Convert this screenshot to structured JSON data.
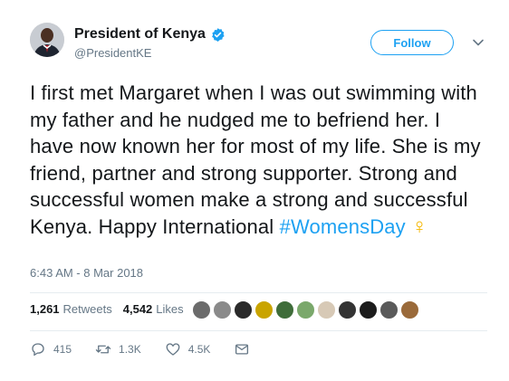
{
  "user": {
    "name": "President of Kenya",
    "handle": "@PresidentKE"
  },
  "follow_label": "Follow",
  "tweet": {
    "text_main": "I first met Margaret when I was out swimming with my father and he nudged me to befriend her. I have now known her for most of my life. She is my friend, partner and strong supporter.  Strong and successful women make a strong and successful Kenya. Happy International ",
    "hashtag": "#WomensDay",
    "emoji": "♀",
    "timestamp": "6:43 AM - 8 Mar 2018"
  },
  "stats": {
    "retweets_count": "1,261",
    "retweets_label": "Retweets",
    "likes_count": "4,542",
    "likes_label": "Likes"
  },
  "likers": [
    "#6b6b6b",
    "#8a8a8a",
    "#2a2a2a",
    "#c9a400",
    "#3f6d3a",
    "#7aa86b",
    "#d7c9b6",
    "#333333",
    "#1c1c1c",
    "#5a5a5a",
    "#9a6a3a"
  ],
  "actions": {
    "replies": "415",
    "retweets": "1.3K",
    "likes": "4.5K"
  },
  "colors": {
    "accent": "#1da1f2",
    "secondary_text": "#657786",
    "emoji": "#f5b700"
  }
}
